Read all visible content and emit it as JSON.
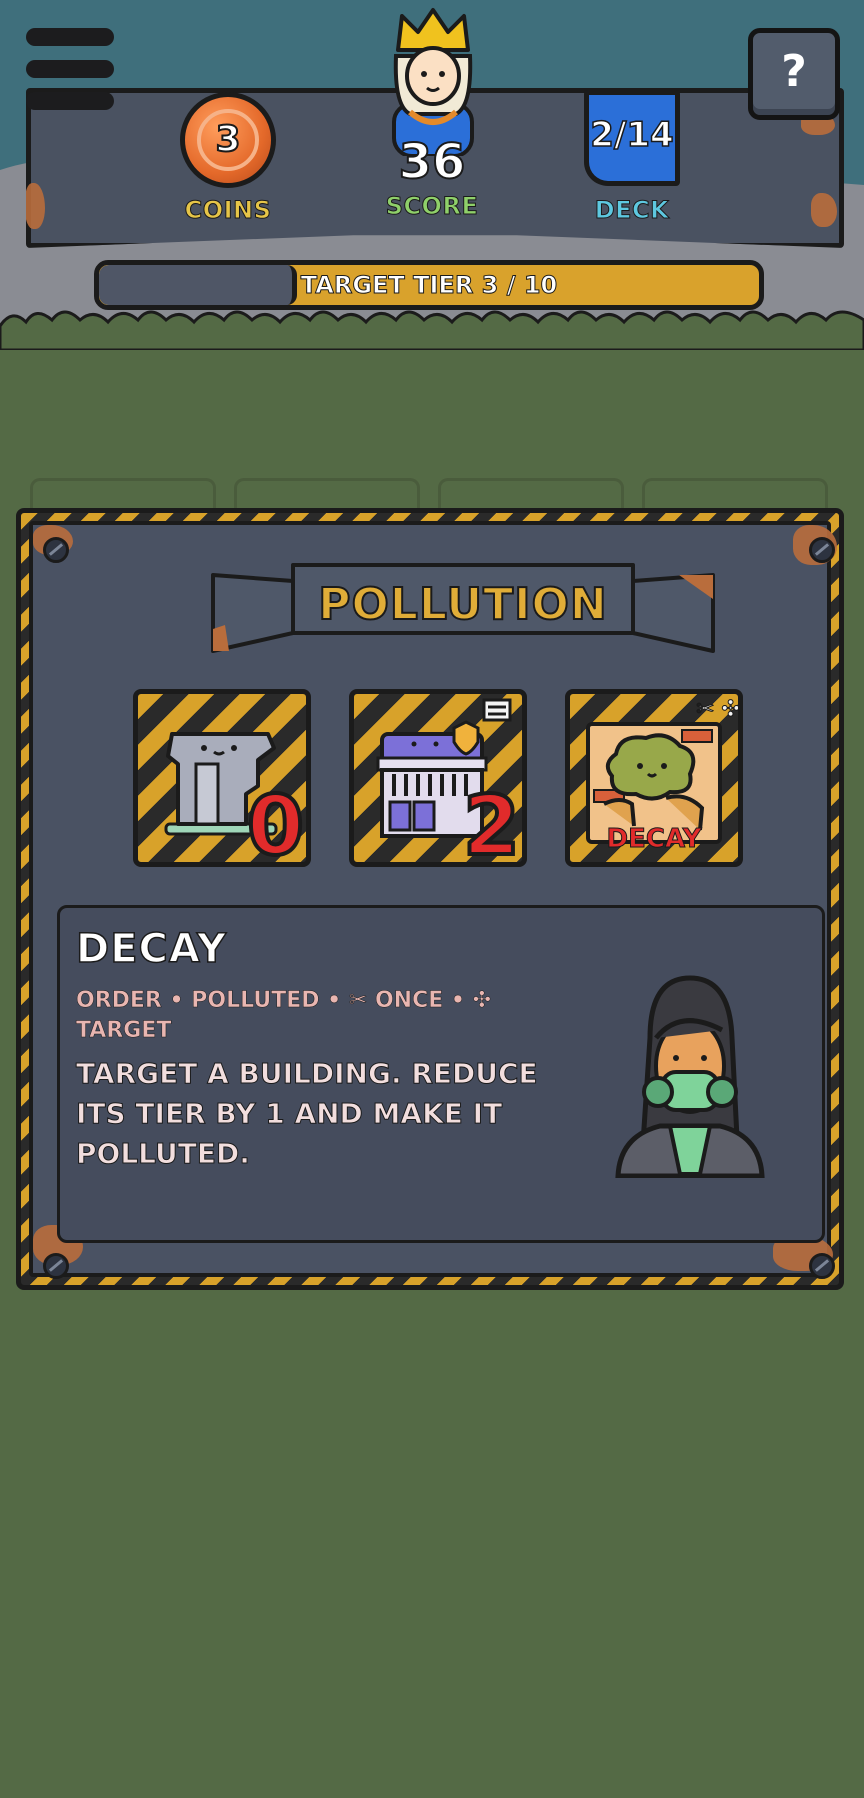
{
  "hud": {
    "coins": {
      "value": "3",
      "label": "COINS"
    },
    "score": {
      "value": "36",
      "label": "SCORE"
    },
    "deck": {
      "value": "2/14",
      "label": "DECK"
    },
    "help_label": "?",
    "target_tier": {
      "text": "TARGET TIER 3 / 10",
      "current": 3,
      "max": 10
    }
  },
  "modal": {
    "title": "POLLUTION",
    "tiles": [
      {
        "icon": "ruined-pillar-icon",
        "value": "0"
      },
      {
        "icon": "police-station-icon",
        "value": "2",
        "badge": "="
      },
      {
        "icon": "pollution-blob-icon",
        "label": "DECAY",
        "badge": "✂ ✣"
      }
    ],
    "info": {
      "title": "DECAY",
      "tags": "ORDER • POLLUTED • ✂ ONCE • ✣ TARGET",
      "description": "TARGET A BUILDING. REDUCE ITS TIER BY 1 AND MAKE IT POLLUTED.",
      "portrait_icon": "gas-mask-character-icon"
    }
  },
  "colors": {
    "grass": "#546a45",
    "sky": "#3f6f7c",
    "panel": "#4a5263",
    "hazard_yellow": "#d8a22a",
    "score_green": "#8fd06a",
    "coin_yellow": "#e6c548",
    "deck_blue": "#5ec8e0",
    "number_red": "#e12b2b"
  }
}
